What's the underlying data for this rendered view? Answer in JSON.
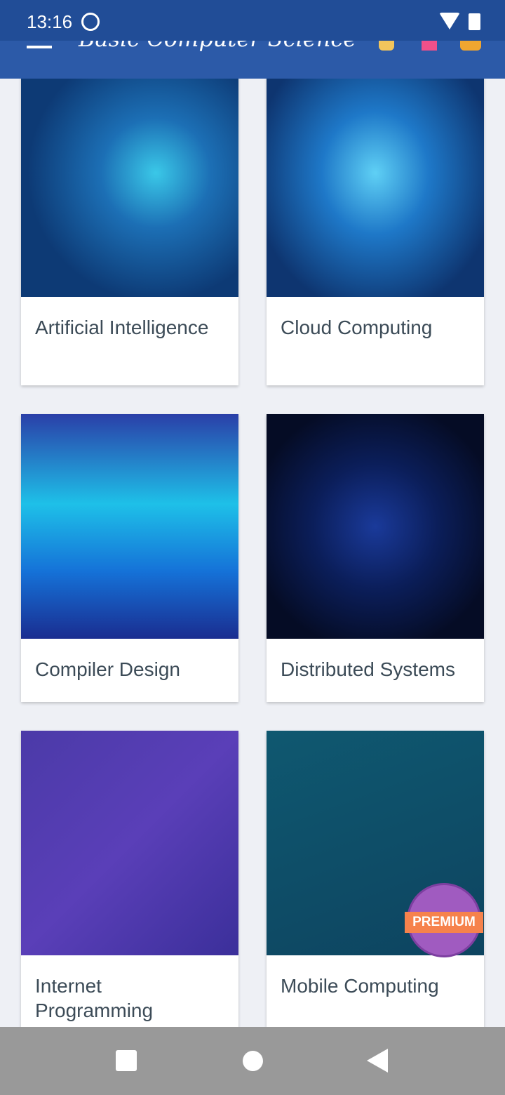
{
  "status_bar": {
    "time": "13:16"
  },
  "toolbar": {
    "title": "Basic Computer Science",
    "icons": [
      "menu-icon",
      "search-icon",
      "bookmark-icon",
      "notification-bell-icon"
    ]
  },
  "cards": [
    {
      "label": "Artificial Intelligence"
    },
    {
      "label": "Cloud Computing"
    },
    {
      "label": "Compiler Design"
    },
    {
      "label": "Distributed Systems"
    },
    {
      "label": "Internet Programming"
    },
    {
      "label": "Mobile Computing"
    }
  ],
  "premium_badge": "PREMIUM",
  "colors": {
    "status_bar": "#214d97",
    "toolbar": "#2c5aa8",
    "background": "#eef0f5"
  }
}
